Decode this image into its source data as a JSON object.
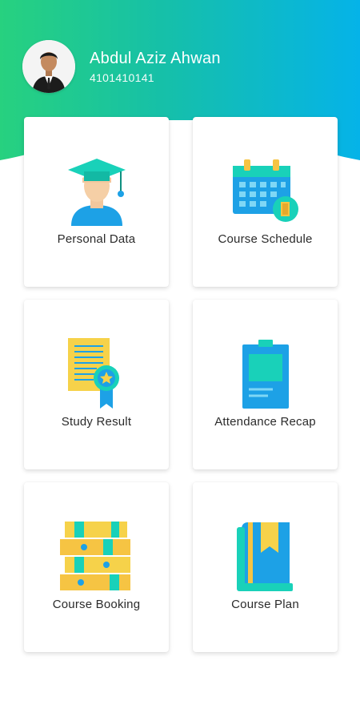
{
  "profile": {
    "name": "Abdul Aziz Ahwan",
    "student_id": "4101410141"
  },
  "menu": [
    {
      "label": "Personal Data",
      "icon": "student-graduate-icon"
    },
    {
      "label": "Course Schedule",
      "icon": "calendar-icon"
    },
    {
      "label": "Study Result",
      "icon": "certificate-icon"
    },
    {
      "label": "Attendance Recap",
      "icon": "clipboard-icon"
    },
    {
      "label": "Course Booking",
      "icon": "stacked-books-icon"
    },
    {
      "label": "Course Plan",
      "icon": "bookmark-book-icon"
    }
  ],
  "colors": {
    "gradient_start": "#27d17f",
    "gradient_end": "#05b3e8",
    "blue": "#1da1e6",
    "yellow": "#f6c443",
    "teal": "#15d6c2"
  }
}
